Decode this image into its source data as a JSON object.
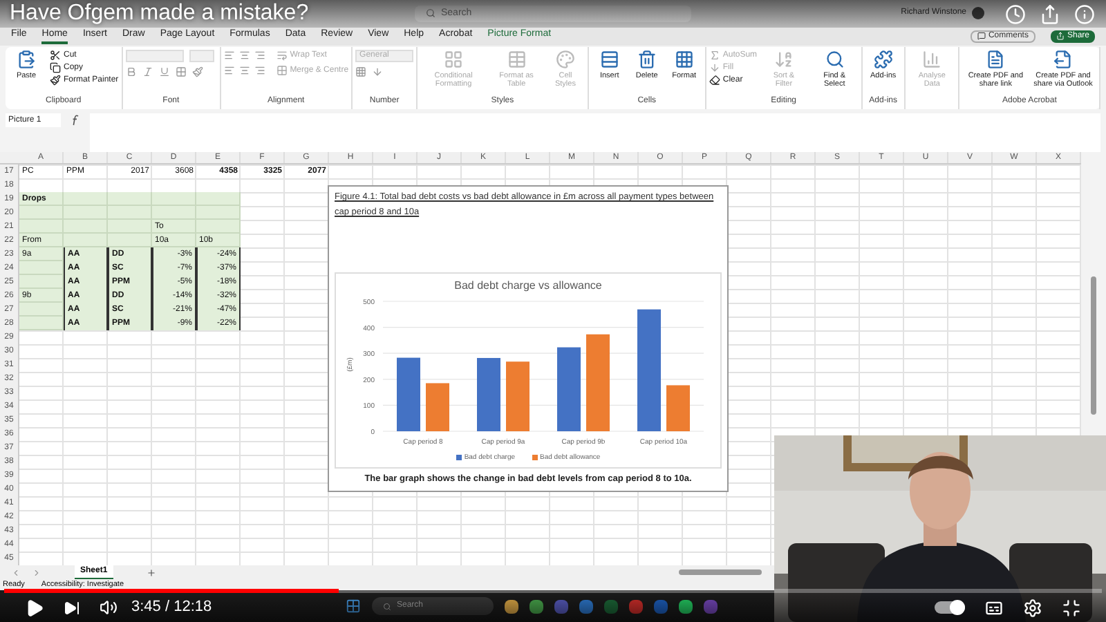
{
  "player": {
    "title": "Have Ofgem made a mistake?",
    "time": "3:45 / 12:18",
    "progress": {
      "level": 0.305
    },
    "autoplay": {
      "on": true
    }
  },
  "excel": {
    "search": {
      "placeholder": "Search"
    },
    "user": "Richard Winstone",
    "tabs": [
      {
        "label": "File",
        "selected": false,
        "contextual": false
      },
      {
        "label": "Home",
        "selected": true,
        "contextual": false
      },
      {
        "label": "Insert",
        "selected": false,
        "contextual": false
      },
      {
        "label": "Draw",
        "selected": false,
        "contextual": false
      },
      {
        "label": "Page Layout",
        "selected": false,
        "contextual": false
      },
      {
        "label": "Formulas",
        "selected": false,
        "contextual": false
      },
      {
        "label": "Data",
        "selected": false,
        "contextual": false
      },
      {
        "label": "Review",
        "selected": false,
        "contextual": false
      },
      {
        "label": "View",
        "selected": false,
        "contextual": false
      },
      {
        "label": "Help",
        "selected": false,
        "contextual": false
      },
      {
        "label": "Acrobat",
        "selected": false,
        "contextual": false
      },
      {
        "label": "Picture Format",
        "selected": false,
        "contextual": true
      }
    ],
    "comments_button": "Comments",
    "share_button": "Share",
    "ribbon_groups": [
      {
        "label": "Clipboard",
        "kind": "clipboard",
        "items": [
          {
            "label": "Paste",
            "disabled": false
          },
          {
            "label": "Cut",
            "disabled": false
          },
          {
            "label": "Copy",
            "disabled": false
          },
          {
            "label": "Format Painter",
            "disabled": false
          }
        ]
      },
      {
        "label": "Font",
        "kind": "font"
      },
      {
        "label": "Alignment",
        "kind": "alignment",
        "items": [
          {
            "label": "Wrap Text",
            "disabled": true
          },
          {
            "label": "Merge & Centre",
            "disabled": true
          }
        ]
      },
      {
        "label": "Number",
        "kind": "number",
        "items": [
          {
            "label": "General",
            "disabled": true
          }
        ]
      },
      {
        "label": "Styles",
        "kind": "large",
        "items": [
          {
            "label": "Conditional Formatting",
            "disabled": true
          },
          {
            "label": "Format as Table",
            "disabled": true
          },
          {
            "label": "Cell Styles",
            "disabled": true
          }
        ]
      },
      {
        "label": "Cells",
        "kind": "large",
        "items": [
          {
            "label": "Insert",
            "disabled": false
          },
          {
            "label": "Delete",
            "disabled": false
          },
          {
            "label": "Format",
            "disabled": false
          }
        ]
      },
      {
        "label": "Editing",
        "kind": "editing",
        "items": [
          {
            "label": "AutoSum",
            "disabled": true
          },
          {
            "label": "Fill",
            "disabled": true
          },
          {
            "label": "Clear",
            "disabled": false
          },
          {
            "label": "Sort & Filter",
            "disabled": true
          },
          {
            "label": "Find & Select",
            "disabled": false
          }
        ]
      },
      {
        "label": "Add-ins",
        "kind": "large",
        "items": [
          {
            "label": "Add-ins",
            "disabled": false
          }
        ]
      },
      {
        "kind": "large",
        "items": [
          {
            "label": "Analyse Data",
            "disabled": true
          }
        ]
      },
      {
        "label": "Adobe Acrobat",
        "kind": "large",
        "items": [
          {
            "label": "Create PDF and share link",
            "disabled": false
          },
          {
            "label": "Create PDF and share via Outlook",
            "disabled": false
          }
        ]
      }
    ],
    "name_box": "Picture 1",
    "columns": [
      "A",
      "B",
      "C",
      "D",
      "E",
      "F",
      "G",
      "H",
      "I",
      "J",
      "K",
      "L",
      "M",
      "N",
      "O",
      "P",
      "Q",
      "R",
      "S",
      "T",
      "U",
      "V",
      "W",
      "X"
    ],
    "rows": [
      {
        "number": "17",
        "cells": [
          {
            "text": "PC",
            "kind": "text",
            "bold": false,
            "shaded": false,
            "boxed": false
          },
          {
            "text": "PPM",
            "kind": "text",
            "bold": false,
            "shaded": false,
            "boxed": false
          },
          {
            "text": "2017",
            "kind": "number",
            "bold": false,
            "shaded": false,
            "boxed": false
          },
          {
            "text": "3608",
            "kind": "number",
            "bold": false,
            "shaded": false,
            "boxed": false
          },
          {
            "text": "4358",
            "kind": "number",
            "bold": true,
            "shaded": false,
            "boxed": false
          },
          {
            "text": "3325",
            "kind": "number",
            "bold": true,
            "shaded": false,
            "boxed": false
          },
          {
            "text": "2077",
            "kind": "number",
            "bold": true,
            "shaded": false,
            "boxed": false
          }
        ]
      },
      {
        "number": "18"
      },
      {
        "number": "19",
        "cells": [
          {
            "text": "Drops",
            "kind": "text",
            "bold": true,
            "shaded": true,
            "boxed": false
          },
          {
            "shaded": true,
            "boxed": false
          },
          {
            "shaded": true,
            "boxed": false
          },
          {
            "shaded": true,
            "boxed": false
          },
          {
            "shaded": true,
            "boxed": false
          }
        ]
      },
      {
        "number": "20",
        "cells": [
          {
            "shaded": true,
            "boxed": false
          },
          {
            "shaded": true,
            "boxed": false
          },
          {
            "shaded": true,
            "boxed": false
          },
          {
            "shaded": true,
            "boxed": false
          },
          {
            "shaded": true,
            "boxed": false
          }
        ]
      },
      {
        "number": "21",
        "cells": [
          {
            "shaded": true,
            "boxed": false
          },
          {
            "shaded": true,
            "boxed": false
          },
          {
            "shaded": true,
            "boxed": false
          },
          {
            "text": "To",
            "kind": "text",
            "bold": false,
            "shaded": true,
            "boxed": false
          },
          {
            "shaded": true,
            "boxed": false
          }
        ]
      },
      {
        "number": "22",
        "cells": [
          {
            "text": "From",
            "kind": "text",
            "bold": false,
            "shaded": true,
            "boxed": false
          },
          {
            "shaded": true,
            "boxed": false
          },
          {
            "shaded": true,
            "boxed": false
          },
          {
            "text": "10a",
            "kind": "text",
            "bold": false,
            "shaded": true,
            "boxed": false
          },
          {
            "text": "10b",
            "kind": "text",
            "bold": false,
            "shaded": true,
            "boxed": false
          }
        ]
      },
      {
        "number": "23",
        "cells": [
          {
            "text": "9a",
            "kind": "text",
            "bold": false,
            "shaded": true,
            "boxed": false
          },
          {
            "text": "AA",
            "kind": "text",
            "bold": true,
            "shaded": true,
            "boxed": true
          },
          {
            "text": "DD",
            "kind": "text",
            "bold": true,
            "shaded": true,
            "boxed": true
          },
          {
            "text": "-3%",
            "kind": "number",
            "bold": false,
            "shaded": true,
            "boxed": true
          },
          {
            "text": "-24%",
            "kind": "number",
            "bold": false,
            "shaded": true,
            "boxed": true
          }
        ]
      },
      {
        "number": "24",
        "cells": [
          {
            "shaded": true,
            "boxed": false
          },
          {
            "text": "AA",
            "kind": "text",
            "bold": true,
            "shaded": true,
            "boxed": true
          },
          {
            "text": "SC",
            "kind": "text",
            "bold": true,
            "shaded": true,
            "boxed": true
          },
          {
            "text": "-7%",
            "kind": "number",
            "bold": false,
            "shaded": true,
            "boxed": true
          },
          {
            "text": "-37%",
            "kind": "number",
            "bold": false,
            "shaded": true,
            "boxed": true
          }
        ]
      },
      {
        "number": "25",
        "cells": [
          {
            "shaded": true,
            "boxed": false
          },
          {
            "text": "AA",
            "kind": "text",
            "bold": true,
            "shaded": true,
            "boxed": true
          },
          {
            "text": "PPM",
            "kind": "text",
            "bold": true,
            "shaded": true,
            "boxed": true
          },
          {
            "text": "-5%",
            "kind": "number",
            "bold": false,
            "shaded": true,
            "boxed": true
          },
          {
            "text": "-18%",
            "kind": "number",
            "bold": false,
            "shaded": true,
            "boxed": true
          }
        ]
      },
      {
        "number": "26",
        "cells": [
          {
            "text": "9b",
            "kind": "text",
            "bold": false,
            "shaded": true,
            "boxed": false
          },
          {
            "text": "AA",
            "kind": "text",
            "bold": true,
            "shaded": true,
            "boxed": true
          },
          {
            "text": "DD",
            "kind": "text",
            "bold": true,
            "shaded": true,
            "boxed": true
          },
          {
            "text": "-14%",
            "kind": "number",
            "bold": false,
            "shaded": true,
            "boxed": true
          },
          {
            "text": "-32%",
            "kind": "number",
            "bold": false,
            "shaded": true,
            "boxed": true
          }
        ]
      },
      {
        "number": "27",
        "cells": [
          {
            "shaded": true,
            "boxed": false
          },
          {
            "text": "AA",
            "kind": "text",
            "bold": true,
            "shaded": true,
            "boxed": true
          },
          {
            "text": "SC",
            "kind": "text",
            "bold": true,
            "shaded": true,
            "boxed": true
          },
          {
            "text": "-21%",
            "kind": "number",
            "bold": false,
            "shaded": true,
            "boxed": true
          },
          {
            "text": "-47%",
            "kind": "number",
            "bold": false,
            "shaded": true,
            "boxed": true
          }
        ]
      },
      {
        "number": "28",
        "cells": [
          {
            "shaded": true,
            "boxed": false
          },
          {
            "text": "AA",
            "kind": "text",
            "bold": true,
            "shaded": true,
            "boxed": true
          },
          {
            "text": "PPM",
            "kind": "text",
            "bold": true,
            "shaded": true,
            "boxed": true
          },
          {
            "text": "-9%",
            "kind": "number",
            "bold": false,
            "shaded": true,
            "boxed": true
          },
          {
            "text": "-22%",
            "kind": "number",
            "bold": false,
            "shaded": true,
            "boxed": true
          }
        ]
      },
      {
        "number": "29"
      },
      {
        "number": "30"
      },
      {
        "number": "31"
      },
      {
        "number": "32"
      },
      {
        "number": "33"
      },
      {
        "number": "34"
      },
      {
        "number": "35"
      },
      {
        "number": "36"
      },
      {
        "number": "37"
      },
      {
        "number": "38"
      },
      {
        "number": "39"
      },
      {
        "number": "40"
      },
      {
        "number": "41"
      },
      {
        "number": "42"
      },
      {
        "number": "43"
      },
      {
        "number": "44"
      },
      {
        "number": "45"
      }
    ],
    "figure": {
      "caption": "Figure 4.1: Total bad debt costs vs bad debt allowance in £m across all payment types between cap period 8 and 10a",
      "chart_data": {
        "type": "bar",
        "title": "Bad debt charge vs allowance",
        "ylabel": "(£m)",
        "categories": [
          "Cap period 8",
          "Cap period 9a",
          "Cap period 9b",
          "Cap period 10a"
        ],
        "series": [
          {
            "name": "Bad debt charge",
            "color": "#4472c4",
            "values": [
              283,
              282,
              323,
              469
            ]
          },
          {
            "name": "Bad debt allowance",
            "color": "#ed7d31",
            "values": [
              185,
              268,
              373,
              177
            ]
          }
        ],
        "ylim": [
          0,
          500
        ],
        "yticks": [
          0,
          100,
          200,
          300,
          400,
          500
        ],
        "grid": true,
        "legend": "bottom"
      },
      "note": "The bar graph shows the change in bad debt levels from cap period 8 to 10a."
    },
    "sheet_tabs": [
      {
        "label": "Sheet1",
        "selected": true
      }
    ],
    "status": [
      "Ready",
      "Accessibility: Investigate"
    ],
    "taskbar_search": {
      "placeholder": "Search"
    }
  }
}
